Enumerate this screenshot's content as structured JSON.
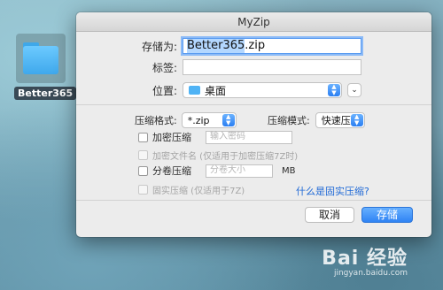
{
  "desktop": {
    "folder_label": "Better365"
  },
  "dialog": {
    "title": "MyZip",
    "save_as_label": "存储为:",
    "save_as_value": "Better365.zip",
    "save_as_selected": "Better365",
    "save_as_ext": ".zip",
    "tags_label": "标签:",
    "tags_value": "",
    "location_label": "位置:",
    "location_value": "桌面",
    "format_label": "压缩格式:",
    "format_value": "*.zip",
    "mode_label": "压缩模式:",
    "mode_value": "快速压缩",
    "encrypt_label": "加密压缩",
    "password_placeholder": "输入密码",
    "encrypt_filename_label": "加密文件名 (仅适用于加密压缩7Z时)",
    "split_label": "分卷压缩",
    "split_placeholder": "分卷大小",
    "split_unit": "MB",
    "solid_label": "固实压缩 (仅适用于7Z)",
    "solid_link": "什么是固实压缩?",
    "cancel_label": "取消",
    "save_label": "存储"
  },
  "watermark": {
    "main": "Bai 经验",
    "sub": "jingyan.baidu.com"
  },
  "colors": {
    "accent": "#2f83f4",
    "link": "#1f69d6"
  }
}
